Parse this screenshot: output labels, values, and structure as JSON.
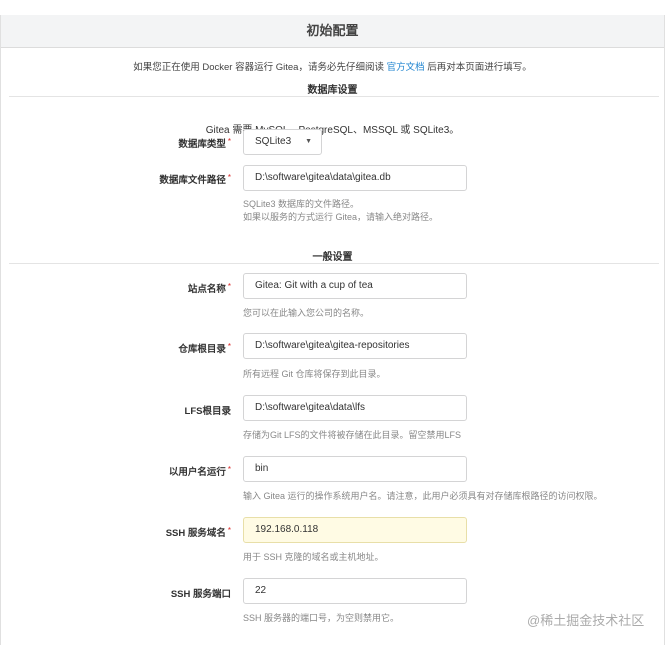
{
  "header": {
    "title": "初始配置"
  },
  "notice": {
    "before": "如果您正在使用 Docker 容器运行 Gitea，请务必先仔细阅读 ",
    "link": "官方文档",
    "after": " 后再对本页面进行填写。"
  },
  "db_section": {
    "title": "数据库设置",
    "info": "Gitea 需要 MySQL、PostgreSQL、MSSQL 或 SQLite3。",
    "type_label": "数据库类型",
    "type_value": "SQLite3",
    "path_label": "数据库文件路径",
    "path_value": "D:\\software\\gitea\\data\\gitea.db",
    "path_help_1": "SQLite3 数据库的文件路径。",
    "path_help_2": "如果以服务的方式运行 Gitea，请输入绝对路径。"
  },
  "general_section": {
    "title": "一般设置",
    "site_name_label": "站点名称",
    "site_name_value": "Gitea: Git with a cup of tea",
    "site_name_help": "您可以在此输入您公司的名称。",
    "repo_root_label": "仓库根目录",
    "repo_root_value": "D:\\software\\gitea\\gitea-repositories",
    "repo_root_help": "所有远程 Git 仓库将保存到此目录。",
    "lfs_label": "LFS根目录",
    "lfs_value": "D:\\software\\gitea\\data\\lfs",
    "lfs_help": "存储为Git LFS的文件将被存储在此目录。留空禁用LFS",
    "run_user_label": "以用户名运行",
    "run_user_value": "bin",
    "run_user_help": "输入 Gitea 运行的操作系统用户名。请注意，此用户必须具有对存储库根路径的访问权限。",
    "ssh_domain_label": "SSH 服务域名",
    "ssh_domain_value": "192.168.0.118",
    "ssh_domain_help": "用于 SSH 克隆的域名或主机地址。",
    "ssh_port_label": "SSH 服务端口",
    "ssh_port_value": "22",
    "ssh_port_help": "SSH 服务器的端口号，为空则禁用它。"
  },
  "required_mark": "*",
  "watermark": "@稀土掘金技术社区"
}
